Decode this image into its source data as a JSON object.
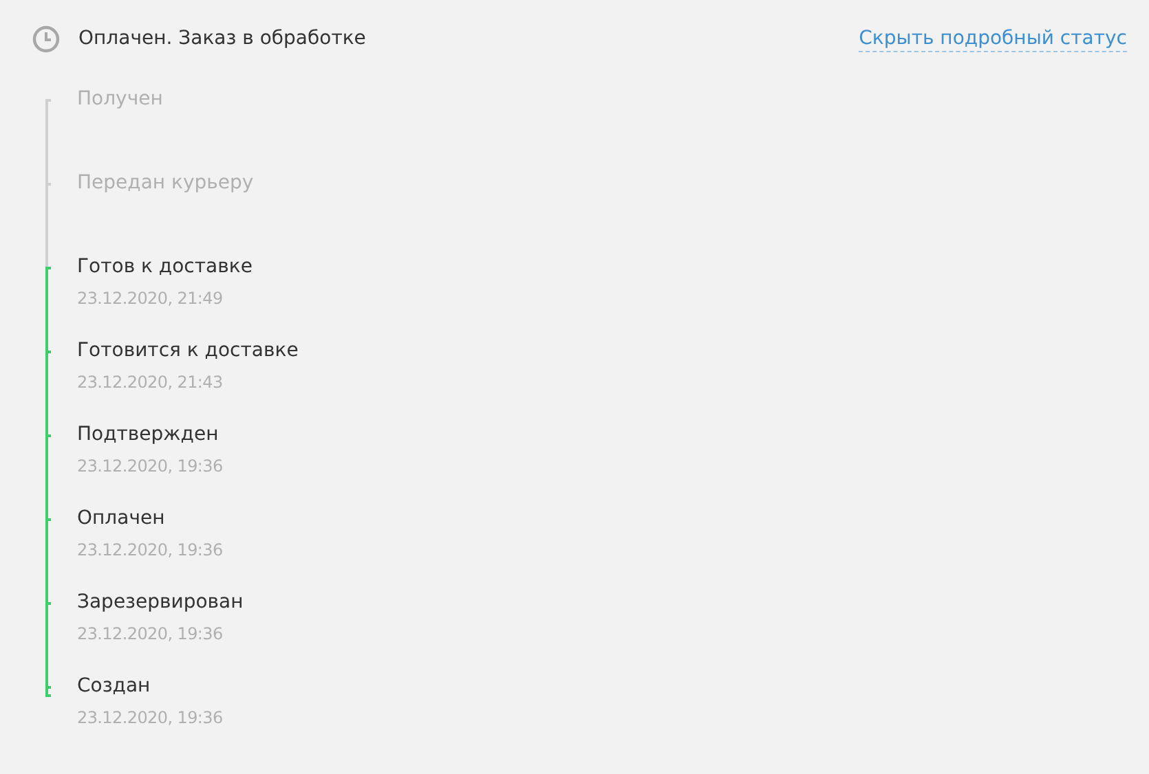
{
  "header": {
    "status": "Оплачен. Заказ в обработке",
    "toggle_link": "Скрыть подробный статус"
  },
  "steps": [
    {
      "name": "Получен",
      "done": false
    },
    {
      "name": "Передан курьеру",
      "done": false
    },
    {
      "name": "Готов к доставке",
      "date": "23.12.2020, 21:49",
      "done": true
    },
    {
      "name": "Готовится к доставке",
      "date": "23.12.2020, 21:43",
      "done": true
    },
    {
      "name": "Подтвержден",
      "date": "23.12.2020, 19:36",
      "done": true
    },
    {
      "name": "Оплачен",
      "date": "23.12.2020, 19:36",
      "done": true
    },
    {
      "name": "Зарезервирован",
      "date": "23.12.2020, 19:36",
      "done": true
    },
    {
      "name": "Создан",
      "date": "23.12.2020, 19:36",
      "done": true
    }
  ]
}
